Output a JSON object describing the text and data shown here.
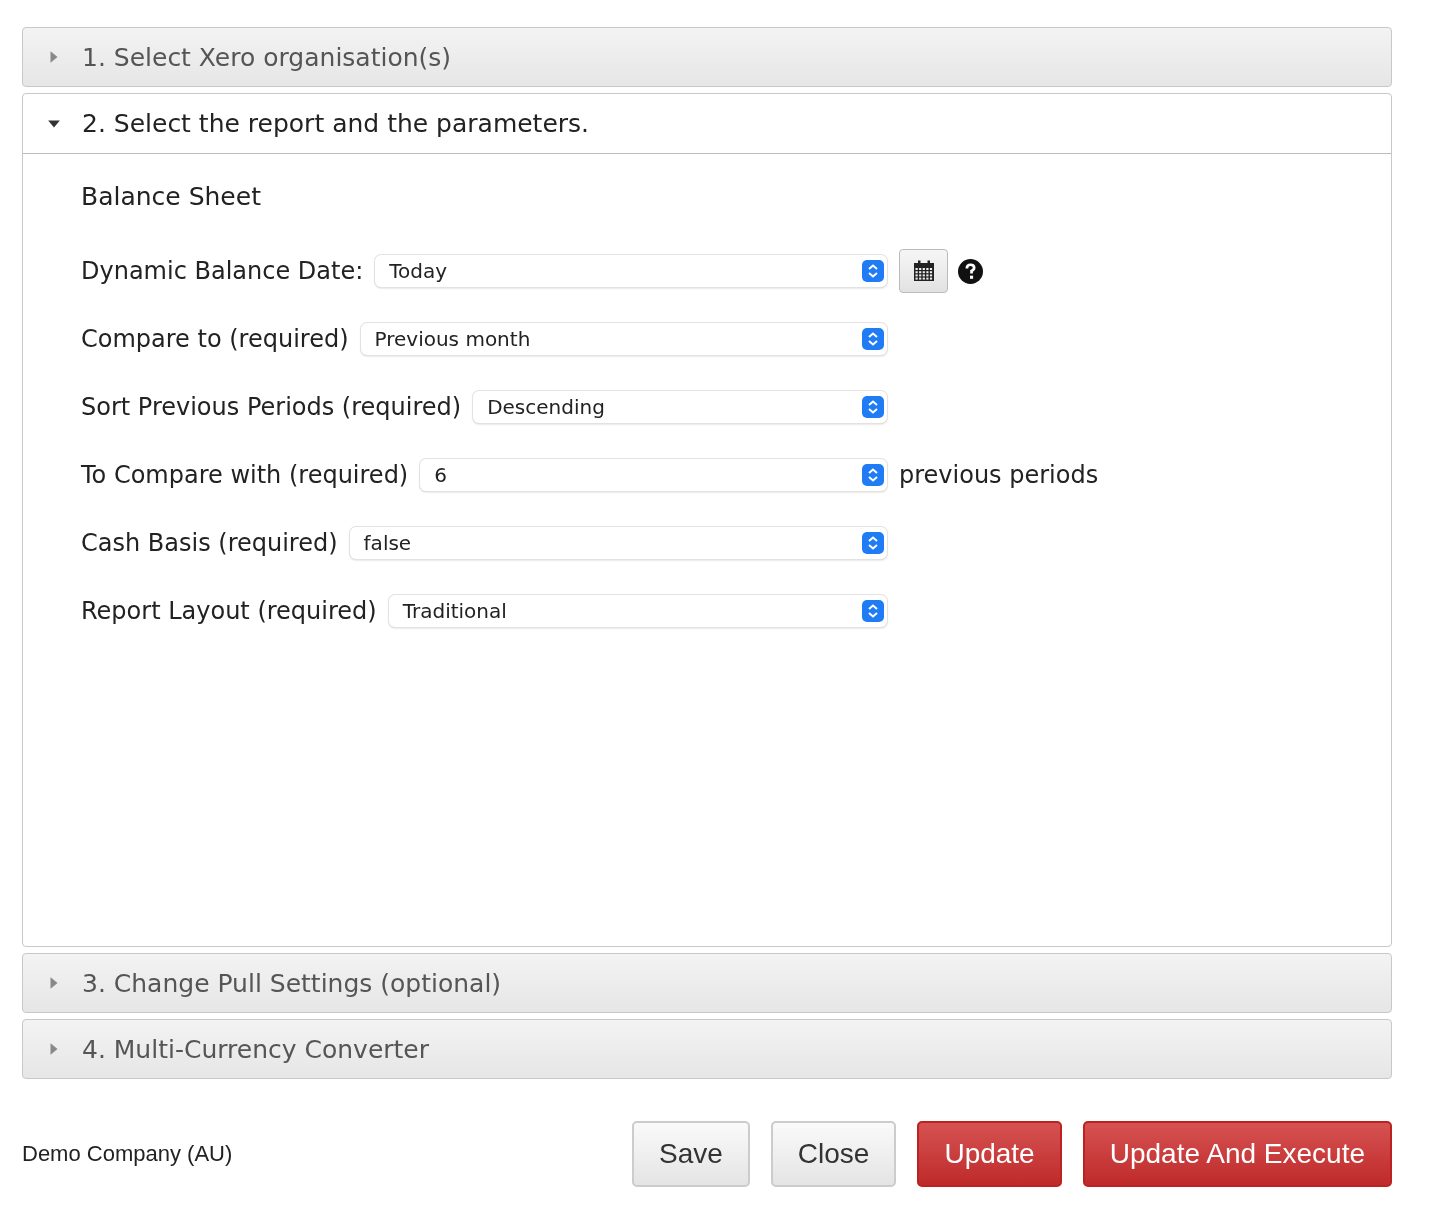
{
  "sections": [
    {
      "title": "1. Select Xero organisation(s)",
      "expanded": false
    },
    {
      "title": "2. Select the report and the parameters.",
      "expanded": true,
      "report": "Balance Sheet",
      "fields": [
        {
          "kind": "date",
          "label": "Dynamic Balance Date:",
          "value": "Today"
        },
        {
          "kind": "select",
          "label": "Compare to (required)",
          "value": "Previous month"
        },
        {
          "kind": "select",
          "label": "Sort Previous Periods (required)",
          "value": "Descending"
        },
        {
          "kind": "select",
          "label": "To Compare with (required)",
          "value": "6",
          "suffix": "previous periods"
        },
        {
          "kind": "select",
          "label": "Cash Basis (required)",
          "value": "false"
        },
        {
          "kind": "select",
          "label": "Report Layout (required)",
          "value": "Traditional"
        }
      ]
    },
    {
      "title": "3. Change Pull Settings (optional)",
      "expanded": false
    },
    {
      "title": "4. Multi-Currency Converter",
      "expanded": false
    }
  ],
  "footer": {
    "company": "Demo Company (AU)",
    "buttons": [
      {
        "label": "Save",
        "kind": "default"
      },
      {
        "label": "Close",
        "kind": "default"
      },
      {
        "label": "Update",
        "kind": "primary"
      },
      {
        "label": "Update And Execute",
        "kind": "primary"
      }
    ]
  }
}
